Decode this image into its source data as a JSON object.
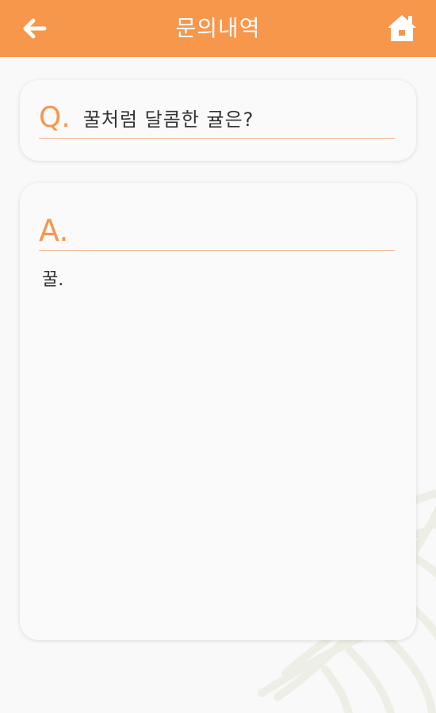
{
  "header": {
    "title": "문의내역",
    "back_icon": "arrow-left-icon",
    "home_icon": "home-icon",
    "color": "#f7974c"
  },
  "question": {
    "marker": "Q.",
    "text": "꿀처럼 달콤한 귤은?"
  },
  "answer": {
    "marker": "A.",
    "text": "꿀."
  }
}
